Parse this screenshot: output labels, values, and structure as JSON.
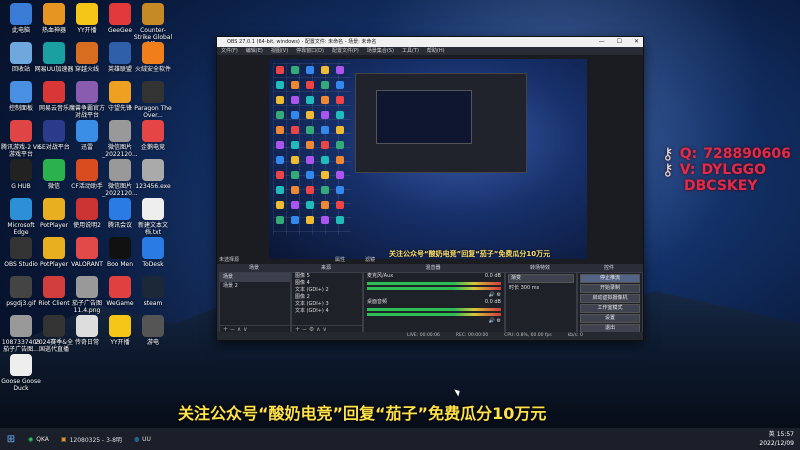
{
  "desktop_icons": [
    {
      "label": "此电脑",
      "icon": "computer-icon",
      "color": "#3a7bd5"
    },
    {
      "label": "热血神器",
      "icon": "app-icon",
      "color": "#e69522"
    },
    {
      "label": "YY开播",
      "icon": "yy-icon",
      "color": "#f5c518"
    },
    {
      "label": "GeeGee",
      "icon": "gg-icon",
      "color": "#e23a3a"
    },
    {
      "label": "Counter-Strike Global Off...",
      "icon": "cs-icon",
      "color": "#c58a26"
    },
    {
      "label": "回收站",
      "icon": "recycle-bin-icon",
      "color": "#6fa8dc"
    },
    {
      "label": "网易UU加速器",
      "icon": "uu-icon",
      "color": "#1aa0a0"
    },
    {
      "label": "穿越火线",
      "icon": "cf-icon",
      "color": "#d96d1f"
    },
    {
      "label": "英雄联盟",
      "icon": "lol-icon",
      "color": "#2e5fa8"
    },
    {
      "label": "火绒安全软件",
      "icon": "huorong-icon",
      "color": "#f07e1b"
    },
    {
      "label": "控制面板",
      "icon": "control-panel-icon",
      "color": "#4a90e2"
    },
    {
      "label": "网易云音乐",
      "icon": "netease-music-icon",
      "color": "#d93636"
    },
    {
      "label": "魔兽争霸官方对战平台",
      "icon": "warcraft-icon",
      "color": "#8a5cb0"
    },
    {
      "label": "守望先锋",
      "icon": "overwatch-icon",
      "color": "#f0a020"
    },
    {
      "label": "Paragon The Over...",
      "icon": "paragon-icon",
      "color": "#333"
    },
    {
      "label": "腾讯游戏-2 VK游戏平台",
      "icon": "tencent-game-icon",
      "color": "#e04545"
    },
    {
      "label": "5E对战平台",
      "icon": "5e-icon",
      "color": "#2b3a8a"
    },
    {
      "label": "迅雷",
      "icon": "xunlei-icon",
      "color": "#3a8ee6"
    },
    {
      "label": "微信图片_2022120...",
      "icon": "image-file-icon",
      "color": "#999"
    },
    {
      "label": "企鹅电竞",
      "icon": "penguin-esports-icon",
      "color": "#e64545"
    },
    {
      "label": "G HUB",
      "icon": "ghub-icon",
      "color": "#222"
    },
    {
      "label": "微信",
      "icon": "wechat-icon",
      "color": "#2bb24c"
    },
    {
      "label": "CF活动助手",
      "icon": "cf-helper-icon",
      "color": "#d94c1f"
    },
    {
      "label": "微信图片_2022120...",
      "icon": "image-file-icon",
      "color": "#999"
    },
    {
      "label": "123456.exe",
      "icon": "exe-icon",
      "color": "#aaa"
    },
    {
      "label": "Microsoft Edge",
      "icon": "edge-icon",
      "color": "#2d8fd5"
    },
    {
      "label": "PotPlayer",
      "icon": "potplayer-icon",
      "color": "#e8b020"
    },
    {
      "label": "使用说明2",
      "icon": "doc-icon",
      "color": "#c33"
    },
    {
      "label": "腾讯会议",
      "icon": "meeting-icon",
      "color": "#2b7be4"
    },
    {
      "label": "新建文本文档.txt",
      "icon": "txt-icon",
      "color": "#eee"
    },
    {
      "label": "OBS Studio",
      "icon": "obs-icon",
      "color": "#333"
    },
    {
      "label": "PotPlayer",
      "icon": "potplayer-icon",
      "color": "#e8b020"
    },
    {
      "label": "VALORANT",
      "icon": "valorant-icon",
      "color": "#e24a4a"
    },
    {
      "label": "Boo Men",
      "icon": "boomen-icon",
      "color": "#111"
    },
    {
      "label": "ToDesk",
      "icon": "todesk-icon",
      "color": "#2b7be4"
    },
    {
      "label": "psgdj3.gif",
      "icon": "gif-icon",
      "color": "#444"
    },
    {
      "label": "Riot Client",
      "icon": "riot-icon",
      "color": "#d13c3c"
    },
    {
      "label": "茄子广告图 11.4.png",
      "icon": "image-file-icon",
      "color": "#999"
    },
    {
      "label": "WeGame",
      "icon": "wegame-icon",
      "color": "#e04040"
    },
    {
      "label": "steam",
      "icon": "steam-icon",
      "color": "#1b2838"
    },
    {
      "label": "1087337403 茄子广告图...",
      "icon": "image-file-icon",
      "color": "#999"
    },
    {
      "label": "2024赛季&全国巡代直播",
      "icon": "mw-icon",
      "color": "#333"
    },
    {
      "label": "传奇日常",
      "icon": "qr-icon",
      "color": "#ddd"
    },
    {
      "label": "YY开播",
      "icon": "yy-icon",
      "color": "#f5c518"
    },
    {
      "label": "游电",
      "icon": "game-icon",
      "color": "#555"
    },
    {
      "label": "Goose Goose Duck",
      "icon": "goose-icon",
      "color": "#eee"
    }
  ],
  "contact": {
    "qq_label": "Q:",
    "qq": "728890606",
    "wx_label": "V:",
    "wx_line1": "DYLGGO",
    "wx_line2": "DBCSKEY"
  },
  "obs": {
    "title": "OBS 27.0.1 (64-bit, windows) - 配置文件: 未命名 - 场景: 未命名",
    "menu": [
      "文件(F)",
      "编辑(E)",
      "视图(V)",
      "停靠窗口(D)",
      "配置文件(P)",
      "场景集合(S)",
      "工具(T)",
      "帮助(H)"
    ],
    "no_source": "未选择源",
    "props": "属性",
    "filters": "滤镜",
    "headers": {
      "scenes": "场景",
      "sources": "来源",
      "mixer": "混音器",
      "transitions": "转场特效",
      "controls": "控件"
    },
    "scenes": [
      "场景",
      "场景 2"
    ],
    "sources": [
      "图像 5",
      "图像 4",
      "文本 (GDI+) 2",
      "图像 2",
      "文本 (GDI+) 3",
      "文本 (GDI+) 4"
    ],
    "mixer": [
      {
        "name": "麦克风/Aux",
        "db": "0.0 dB"
      },
      {
        "name": "桌面音频",
        "db": "0.0 dB"
      }
    ],
    "transition": {
      "type": "渐变",
      "duration_label": "时长",
      "duration": "300 ms"
    },
    "controls": [
      "停止推流",
      "开始录制",
      "启动虚拟摄像机",
      "工作室模式",
      "设置",
      "退出"
    ],
    "status": [
      "LIVE: 00:00:06",
      "REC: 00:00:00",
      "CPU: 0.8%, 60.00 fps",
      "kb/s: 0"
    ]
  },
  "banner": "关注公众号“酸奶电竞”回复“茄子”免费瓜分10万元",
  "banner_small": "关注公众号“酸奶电竞”回复“茄子”免费瓜分10万元",
  "taskbar": {
    "items": [
      "QKA",
      "12080325 - 3-8明",
      "UU"
    ],
    "time": "15:57",
    "date": "2022/12/09",
    "lang": "英"
  }
}
